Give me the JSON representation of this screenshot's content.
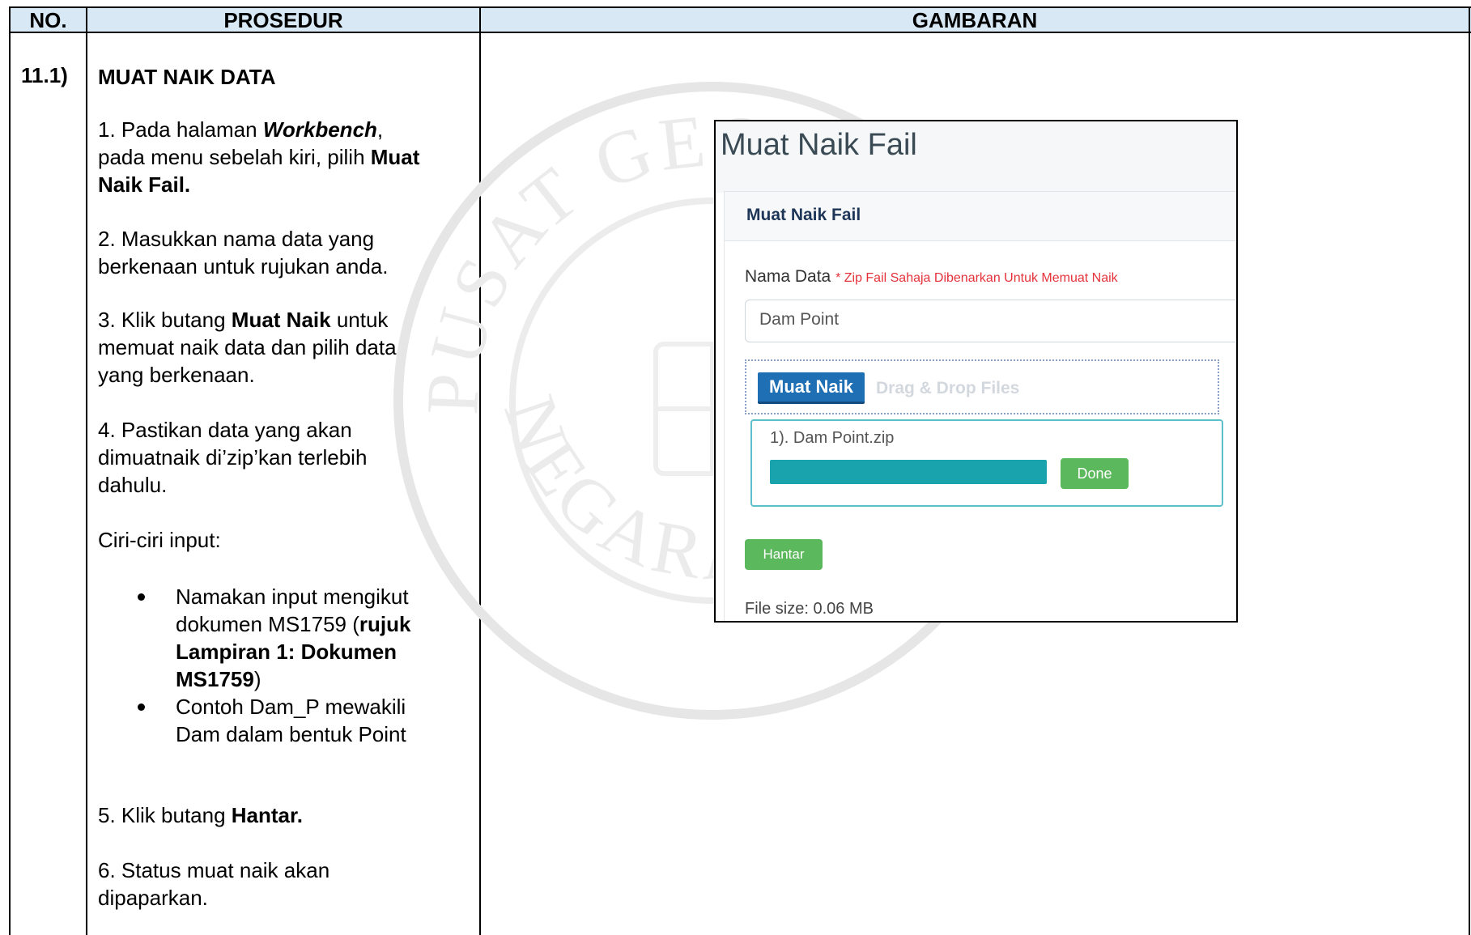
{
  "header": {
    "col_no": "NO.",
    "col_procedure": "PROSEDUR",
    "col_image": "GAMBARAN"
  },
  "section": {
    "number": "11.1)",
    "title": "MUAT NAIK DATA"
  },
  "steps": {
    "s1_a": "1. Pada halaman ",
    "s1_b": "Workbench",
    "s1_c": ",",
    "s1_d": "pada menu sebelah kiri, pilih ",
    "s1_e": "Muat",
    "s1_f": "Naik Fail.",
    "s2_a": "2. Masukkan nama data yang",
    "s2_b": "berkenaan untuk rujukan anda.",
    "s3_a": "3. Klik butang ",
    "s3_b": "Muat Naik",
    "s3_c": " untuk",
    "s3_d": "memuat naik data dan pilih data",
    "s3_e": "yang berkenaan.",
    "s4_a": "4. Pastikan data yang akan",
    "s4_b": "dimuatnaik di’zip’kan terlebih",
    "s4_c": "dahulu.",
    "features_title": "Ciri-ciri input:",
    "b1_a": "Namakan input mengikut",
    "b1_b": "dokumen MS1759 (",
    "b1_c": "rujuk",
    "b1_d": "Lampiran 1: Dokumen",
    "b1_e": "MS1759",
    "b1_f": ")",
    "b2_a": "Contoh Dam_P mewakili",
    "b2_b": "Dam dalam bentuk Point",
    "s5_a": "5. Klik butang ",
    "s5_b": "Hantar.",
    "s6_a": "6. Status muat naik akan",
    "s6_b": "dipaparkan."
  },
  "watermark": {
    "top_text": "PUSAT GEOSPATIAL",
    "bottom_text": "NEGARA (PGN)"
  },
  "screenshot": {
    "page_title": "Muat Naik Fail",
    "panel_title": "Muat Naik Fail",
    "field_label": "Nama Data",
    "field_note": "* Zip Fail Sahaja Dibenarkan Untuk Memuat Naik",
    "field_value": "Dam Point",
    "upload_button": "Muat Naik",
    "drop_text": "Drag & Drop Files",
    "file_name": "1). Dam Point.zip",
    "upload_progress": 1.0,
    "done_button": "Done",
    "submit_button": "Hantar",
    "file_size": "File size: 0.06 MB",
    "colors": {
      "upload_button": "#1f6fb5",
      "progress": "#19a3ad",
      "success_button": "#5cb85c",
      "required_note": "#e5323a"
    }
  }
}
